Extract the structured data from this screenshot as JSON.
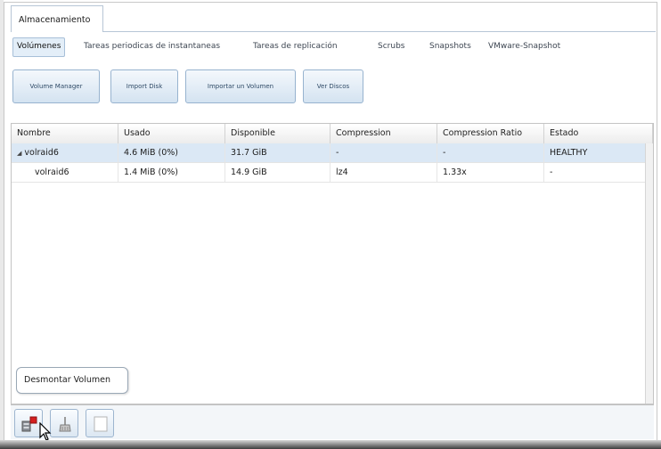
{
  "main_tab": {
    "label": "Almacenamiento"
  },
  "subtabs": [
    {
      "label": "Volúmenes",
      "active": true
    },
    {
      "label": "Tareas periodicas de instantaneas",
      "active": false
    },
    {
      "label": "Tareas de replicación",
      "active": false
    },
    {
      "label": "Scrubs",
      "active": false
    },
    {
      "label": "Snapshots",
      "active": false
    },
    {
      "label": "VMware-Snapshot",
      "active": false
    }
  ],
  "actions": {
    "volume_manager": "Volume Manager",
    "import_disk": "Import Disk",
    "importar_volumen": "Importar un Volumen",
    "ver_discos": "Ver Discos"
  },
  "table": {
    "columns": [
      "Nombre",
      "Usado",
      "Disponible",
      "Compression",
      "Compression Ratio",
      "Estado"
    ],
    "rows": [
      {
        "nombre": "volraid6",
        "usado": "4.6 MiB (0%)",
        "disponible": "31.7 GiB",
        "compression": "-",
        "ratio": "-",
        "estado": "HEALTHY",
        "expanded": true,
        "selected": true
      },
      {
        "nombre": "volraid6",
        "usado": "1.4 MiB (0%)",
        "disponible": "14.9 GiB",
        "compression": "lz4",
        "ratio": "1.33x",
        "estado": "-",
        "expanded": false,
        "selected": false
      }
    ]
  },
  "tooltip": {
    "text": "Desmontar Volumen"
  },
  "toolbar": {
    "buttons": [
      {
        "icon": "detach-volume-icon"
      },
      {
        "icon": "scrub-icon"
      },
      {
        "icon": "blank-icon"
      }
    ]
  },
  "colors": {
    "selected_row": "#dbe8f5",
    "button_border": "#97b3cf",
    "detach_red": "#d42020"
  }
}
